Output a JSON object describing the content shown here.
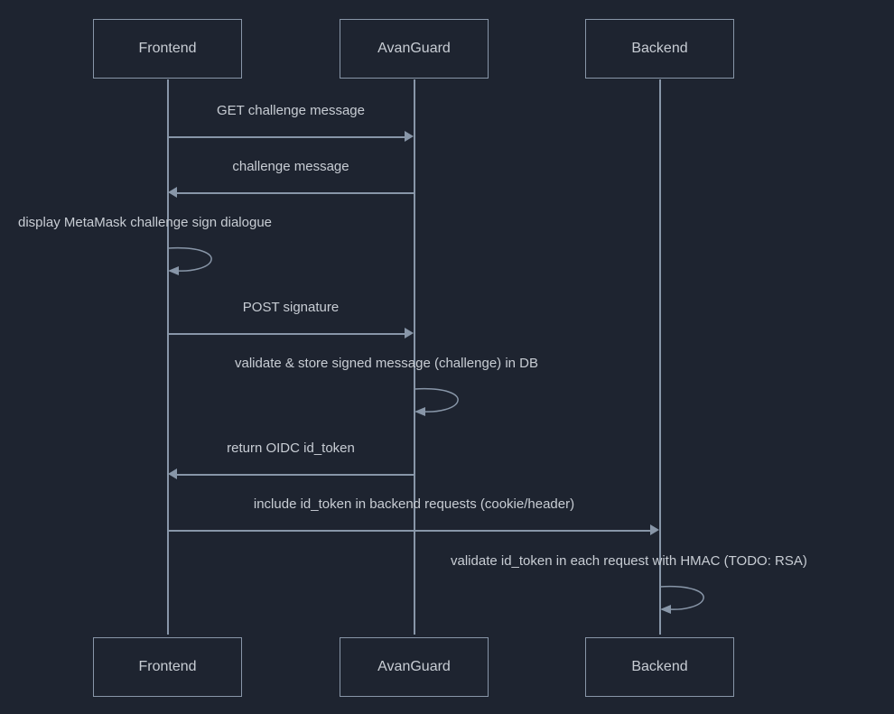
{
  "participants": {
    "frontend": "Frontend",
    "avanguard": "AvanGuard",
    "backend": "Backend"
  },
  "messages": {
    "m1": "GET challenge message",
    "m2": "challenge message",
    "m3": "display MetaMask challenge sign dialogue",
    "m4": "POST signature",
    "m5": "validate & store signed message (challenge) in DB",
    "m6": "return OIDC id_token",
    "m7": "include id_token in backend requests (cookie/header)",
    "m8": "validate id_token in each request with HMAC (TODO: RSA)"
  },
  "chart_data": {
    "type": "sequence-diagram",
    "participants": [
      "Frontend",
      "AvanGuard",
      "Backend"
    ],
    "steps": [
      {
        "from": "Frontend",
        "to": "AvanGuard",
        "label": "GET challenge message"
      },
      {
        "from": "AvanGuard",
        "to": "Frontend",
        "label": "challenge message"
      },
      {
        "from": "Frontend",
        "to": "Frontend",
        "label": "display MetaMask challenge sign dialogue"
      },
      {
        "from": "Frontend",
        "to": "AvanGuard",
        "label": "POST signature"
      },
      {
        "from": "AvanGuard",
        "to": "AvanGuard",
        "label": "validate & store signed message (challenge) in DB"
      },
      {
        "from": "AvanGuard",
        "to": "Frontend",
        "label": "return OIDC id_token"
      },
      {
        "from": "Frontend",
        "to": "Backend",
        "label": "include id_token in backend requests (cookie/header)"
      },
      {
        "from": "Backend",
        "to": "Backend",
        "label": "validate id_token in each request with HMAC (TODO: RSA)"
      }
    ]
  }
}
